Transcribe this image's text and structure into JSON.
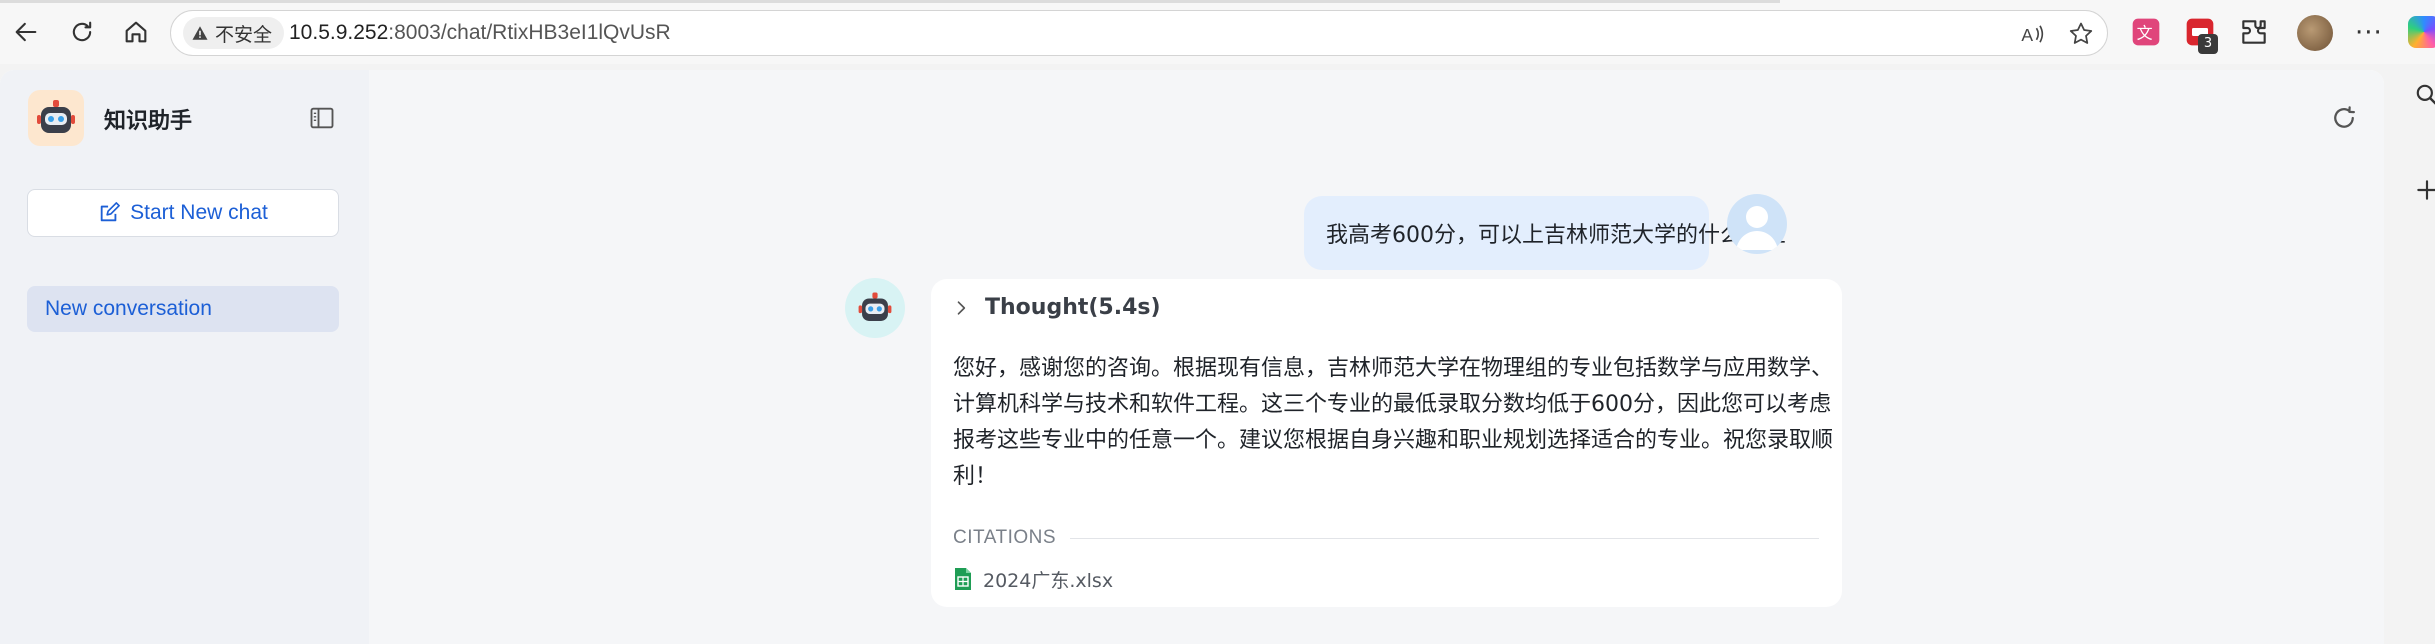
{
  "browser": {
    "security_label": "不安全",
    "url_host": "10.5.9.252",
    "url_rest": ":8003/chat/RtixHB3eI1lQvUsR",
    "extension_badge": "3"
  },
  "sidebar": {
    "brand_name": "知识助手",
    "new_chat_label": "Start New chat",
    "conversations": [
      {
        "label": "New conversation",
        "active": true
      }
    ]
  },
  "chat": {
    "user_message": "我高考600分，可以上吉林师范大学的什么专业",
    "bot": {
      "thought_label": "Thought(5.4s)",
      "answer": "您好，感谢您的咨询。根据现有信息，吉林师范大学在物理组的专业包括数学与应用数学、计算机科学与技术和软件工程。这三个专业的最低录取分数均低于600分，因此您可以考虑报考这些专业中的任意一个。建议您根据自身兴趣和职业规划选择适合的专业。祝您录取顺利！",
      "citations_label": "CITATIONS",
      "citations": [
        {
          "file": "2024广东.xlsx"
        }
      ]
    }
  },
  "colors": {
    "accent": "#1c5fd6",
    "sidebar_bg": "#f0f2f6",
    "user_bubble": "#e3eefd",
    "main_bg": "#f5f6f8"
  },
  "icons": {
    "back": "back-arrow-icon",
    "reload": "reload-icon",
    "home": "home-icon",
    "warning": "warning-icon",
    "read_aloud": "read-aloud-icon",
    "favorite": "star-icon",
    "new_chat": "edit-icon",
    "sidebar_toggle": "sidebar-toggle-icon",
    "refresh": "refresh-icon",
    "expand": "chevron-right-icon",
    "file": "spreadsheet-icon"
  }
}
